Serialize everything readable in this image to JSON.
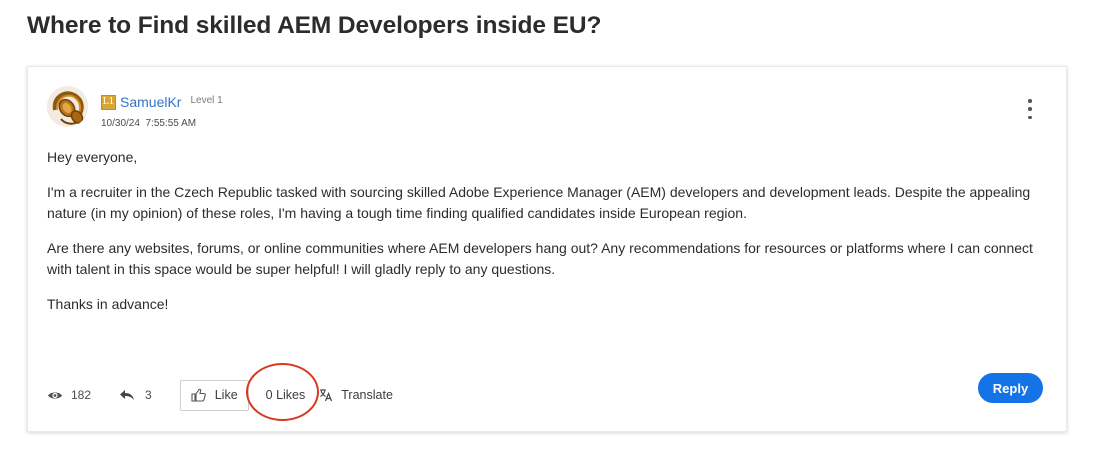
{
  "page": {
    "title": "Where to Find skilled AEM Developers inside EU?"
  },
  "post": {
    "author": {
      "rank_badge": "L1",
      "name": "SamuelKr",
      "level": "Level 1",
      "avatar_icon": "headphones-avatar"
    },
    "date": "10/30/24",
    "time": "7:55:55 AM",
    "paragraphs": [
      "Hey everyone,",
      "I'm a recruiter in the Czech Republic tasked with sourcing skilled Adobe Experience Manager (AEM) developers and development leads. Despite the appealing nature (in my opinion) of these roles, I'm having a tough time finding qualified candidates inside European region.",
      "Are there any websites, forums, or online communities where AEM developers hang out? Any recommendations for resources or platforms where I can connect with talent in this space would be super helpful! I will gladly reply to any questions.",
      "Thanks in advance!"
    ],
    "menu_icon": "kebab-menu-icon"
  },
  "footer": {
    "views": "182",
    "views_icon": "eye-icon",
    "replies": "3",
    "replies_icon": "reply-arrow-icon",
    "like_label": "Like",
    "like_icon": "thumbs-up-icon",
    "likes_count": "0 Likes",
    "translate_label": "Translate",
    "translate_icon": "translate-icon",
    "reply_label": "Reply"
  },
  "colors": {
    "accent": "#1473e6",
    "author_link": "#3574c7",
    "rank_badge": "#d9a533",
    "highlight_ring": "#d9381e"
  }
}
